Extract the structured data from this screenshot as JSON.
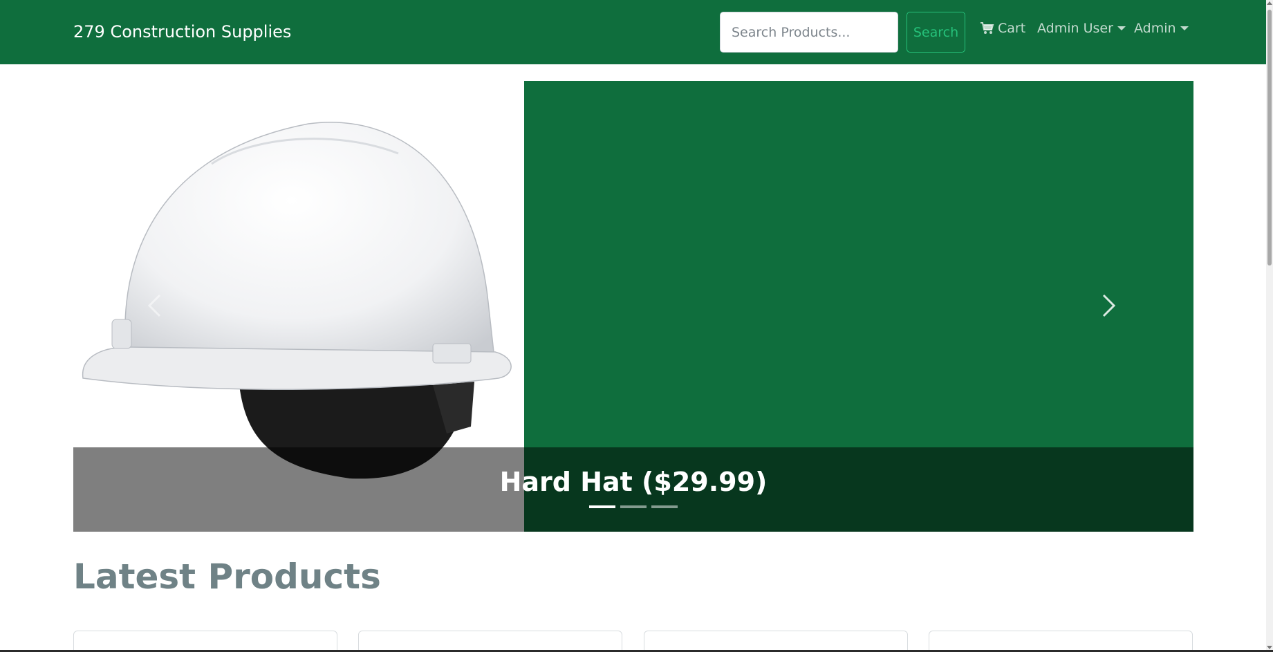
{
  "navbar": {
    "brand": "279 Construction Supplies",
    "search": {
      "placeholder": "Search Products...",
      "value": "",
      "button_label": "Search"
    },
    "cart_label": "Cart",
    "user_menu_label": "Admin User",
    "admin_menu_label": "Admin"
  },
  "carousel": {
    "active_slide_caption": "Hard Hat ($29.99)",
    "slide_count": 3,
    "active_index": 0,
    "background_color": "#0f6e3d",
    "image_icon": "hard-hat-image"
  },
  "main": {
    "section_title": "Latest Products",
    "product_cards_visible": 4
  },
  "colors": {
    "navbar": "#0f6e3d",
    "search_button": "#26c27b",
    "section_title": "#6f8286"
  }
}
